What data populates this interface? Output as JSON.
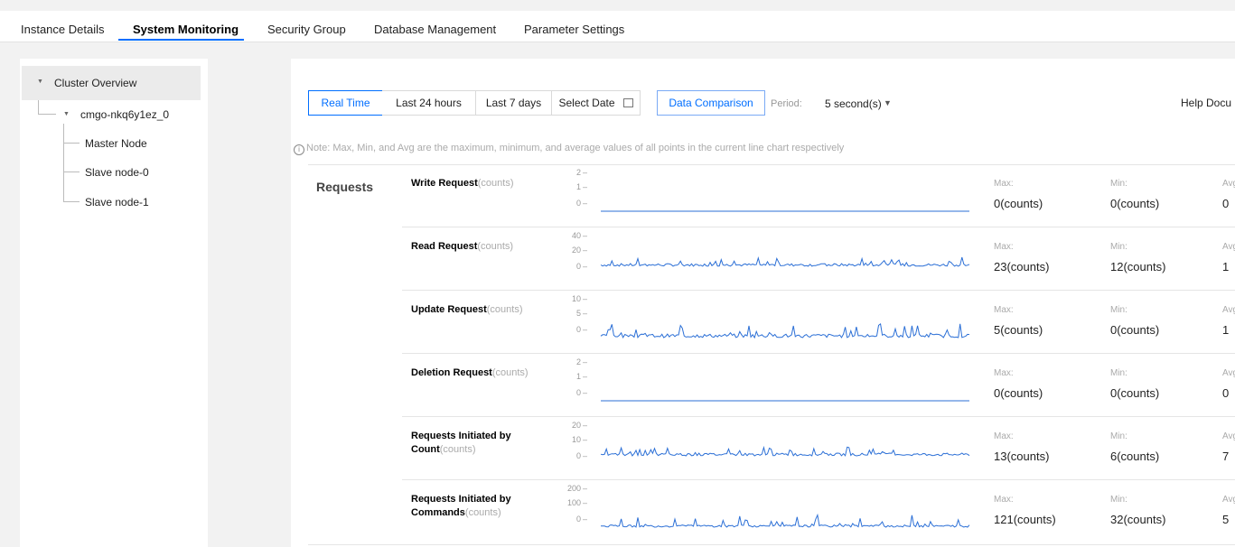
{
  "tabs": [
    "Instance Details",
    "System Monitoring",
    "Security Group",
    "Database Management",
    "Parameter Settings"
  ],
  "sidebar": {
    "root": "Cluster Overview",
    "cluster": "cmgo-nkq6y1ez_0",
    "nodes": [
      "Master Node",
      "Slave node-0",
      "Slave node-1"
    ]
  },
  "toolbar": {
    "range_buttons": [
      "Real Time",
      "Last 24 hours",
      "Last 7 days",
      "Select Date"
    ],
    "compare": "Data Comparison",
    "period_label": "Period:",
    "period_value": "5 second(s)",
    "help": "Help Docu"
  },
  "note": "Note: Max, Min, and Avg are the maximum, minimum, and average values of all points in the current line chart respectively",
  "group_label": "Requests",
  "stat_labels": {
    "max": "Max:",
    "min": "Min:",
    "avg": "Avg:"
  },
  "colors": {
    "accent": "#006eff",
    "line": "#2b6fd6"
  },
  "metrics": [
    {
      "name": "Write Request",
      "unit": "(counts)",
      "yticks": [
        "2",
        "1",
        "0"
      ],
      "max": "0(counts)",
      "min": "0(counts)",
      "avg": "0"
    },
    {
      "name": "Read Request",
      "unit": "(counts)",
      "yticks": [
        "40",
        "20",
        "0"
      ],
      "max": "23(counts)",
      "min": "12(counts)",
      "avg": "1"
    },
    {
      "name": "Update Request",
      "unit": "(counts)",
      "yticks": [
        "10",
        "5",
        "0"
      ],
      "max": "5(counts)",
      "min": "0(counts)",
      "avg": "1"
    },
    {
      "name": "Deletion Request",
      "unit": "(counts)",
      "yticks": [
        "2",
        "1",
        "0"
      ],
      "max": "0(counts)",
      "min": "0(counts)",
      "avg": "0"
    },
    {
      "name": "Requests Initiated by Count",
      "unit": "(counts)",
      "yticks": [
        "20",
        "10",
        "0"
      ],
      "max": "13(counts)",
      "min": "6(counts)",
      "avg": "7"
    },
    {
      "name": "Requests Initiated by Commands",
      "unit": "(counts)",
      "yticks": [
        "200",
        "100",
        "0"
      ],
      "max": "121(counts)",
      "min": "32(counts)",
      "avg": "5"
    }
  ]
}
